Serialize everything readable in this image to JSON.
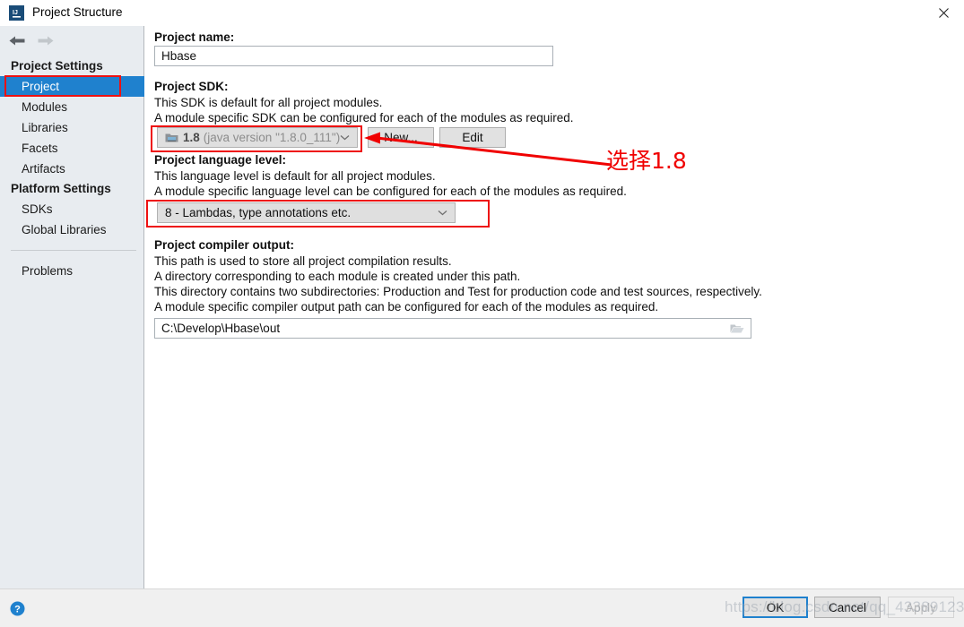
{
  "window": {
    "title": "Project Structure",
    "app_icon": "intellij-idea-icon",
    "close_label": "✕"
  },
  "nav": {
    "back_icon": "arrow-left-icon",
    "forward_icon": "arrow-right-icon"
  },
  "sidebar": {
    "sections": [
      {
        "heading": "Project Settings",
        "items": [
          {
            "label": "Project",
            "selected": true
          },
          {
            "label": "Modules",
            "selected": false
          },
          {
            "label": "Libraries",
            "selected": false
          },
          {
            "label": "Facets",
            "selected": false
          },
          {
            "label": "Artifacts",
            "selected": false
          }
        ]
      },
      {
        "heading": "Platform Settings",
        "items": [
          {
            "label": "SDKs",
            "selected": false
          },
          {
            "label": "Global Libraries",
            "selected": false
          }
        ]
      }
    ],
    "footer_items": [
      {
        "label": "Problems",
        "selected": false
      }
    ]
  },
  "main": {
    "project_name": {
      "label": "Project name:",
      "value": "Hbase",
      "placeholder": ""
    },
    "project_sdk": {
      "label": "Project SDK:",
      "description_lines": [
        "This SDK is default for all project modules.",
        "A module specific SDK can be configured for each of the modules as required."
      ],
      "selected_version": "1.8",
      "selected_detail": "(java version \"1.8.0_111\")",
      "sdk_icon": "jdk-folder-icon",
      "new_button": "New...",
      "edit_button": "Edit"
    },
    "language_level": {
      "label": "Project language level:",
      "description_lines": [
        "This language level is default for all project modules.",
        "A module specific language level can be configured for each of the modules as required."
      ],
      "selected": "8 - Lambdas, type annotations etc."
    },
    "compiler_output": {
      "label": "Project compiler output:",
      "description_lines": [
        "This path is used to store all project compilation results.",
        "A directory corresponding to each module is created under this path.",
        "This directory contains two subdirectories: Production and Test for production code and test sources, respectively.",
        "A module specific compiler output path can be configured for each of the modules as required."
      ],
      "value": "C:\\Develop\\Hbase\\out",
      "browse_icon": "folder-browse-icon"
    }
  },
  "annotations": {
    "select_18_text": "选择1.8",
    "color": "#f00000"
  },
  "footer": {
    "help_icon": "help-question-icon",
    "ok_button": "OK",
    "cancel_button": "Cancel",
    "apply_button": "Apply",
    "watermark": "https://blog.csdn.net/qq_43389123"
  }
}
